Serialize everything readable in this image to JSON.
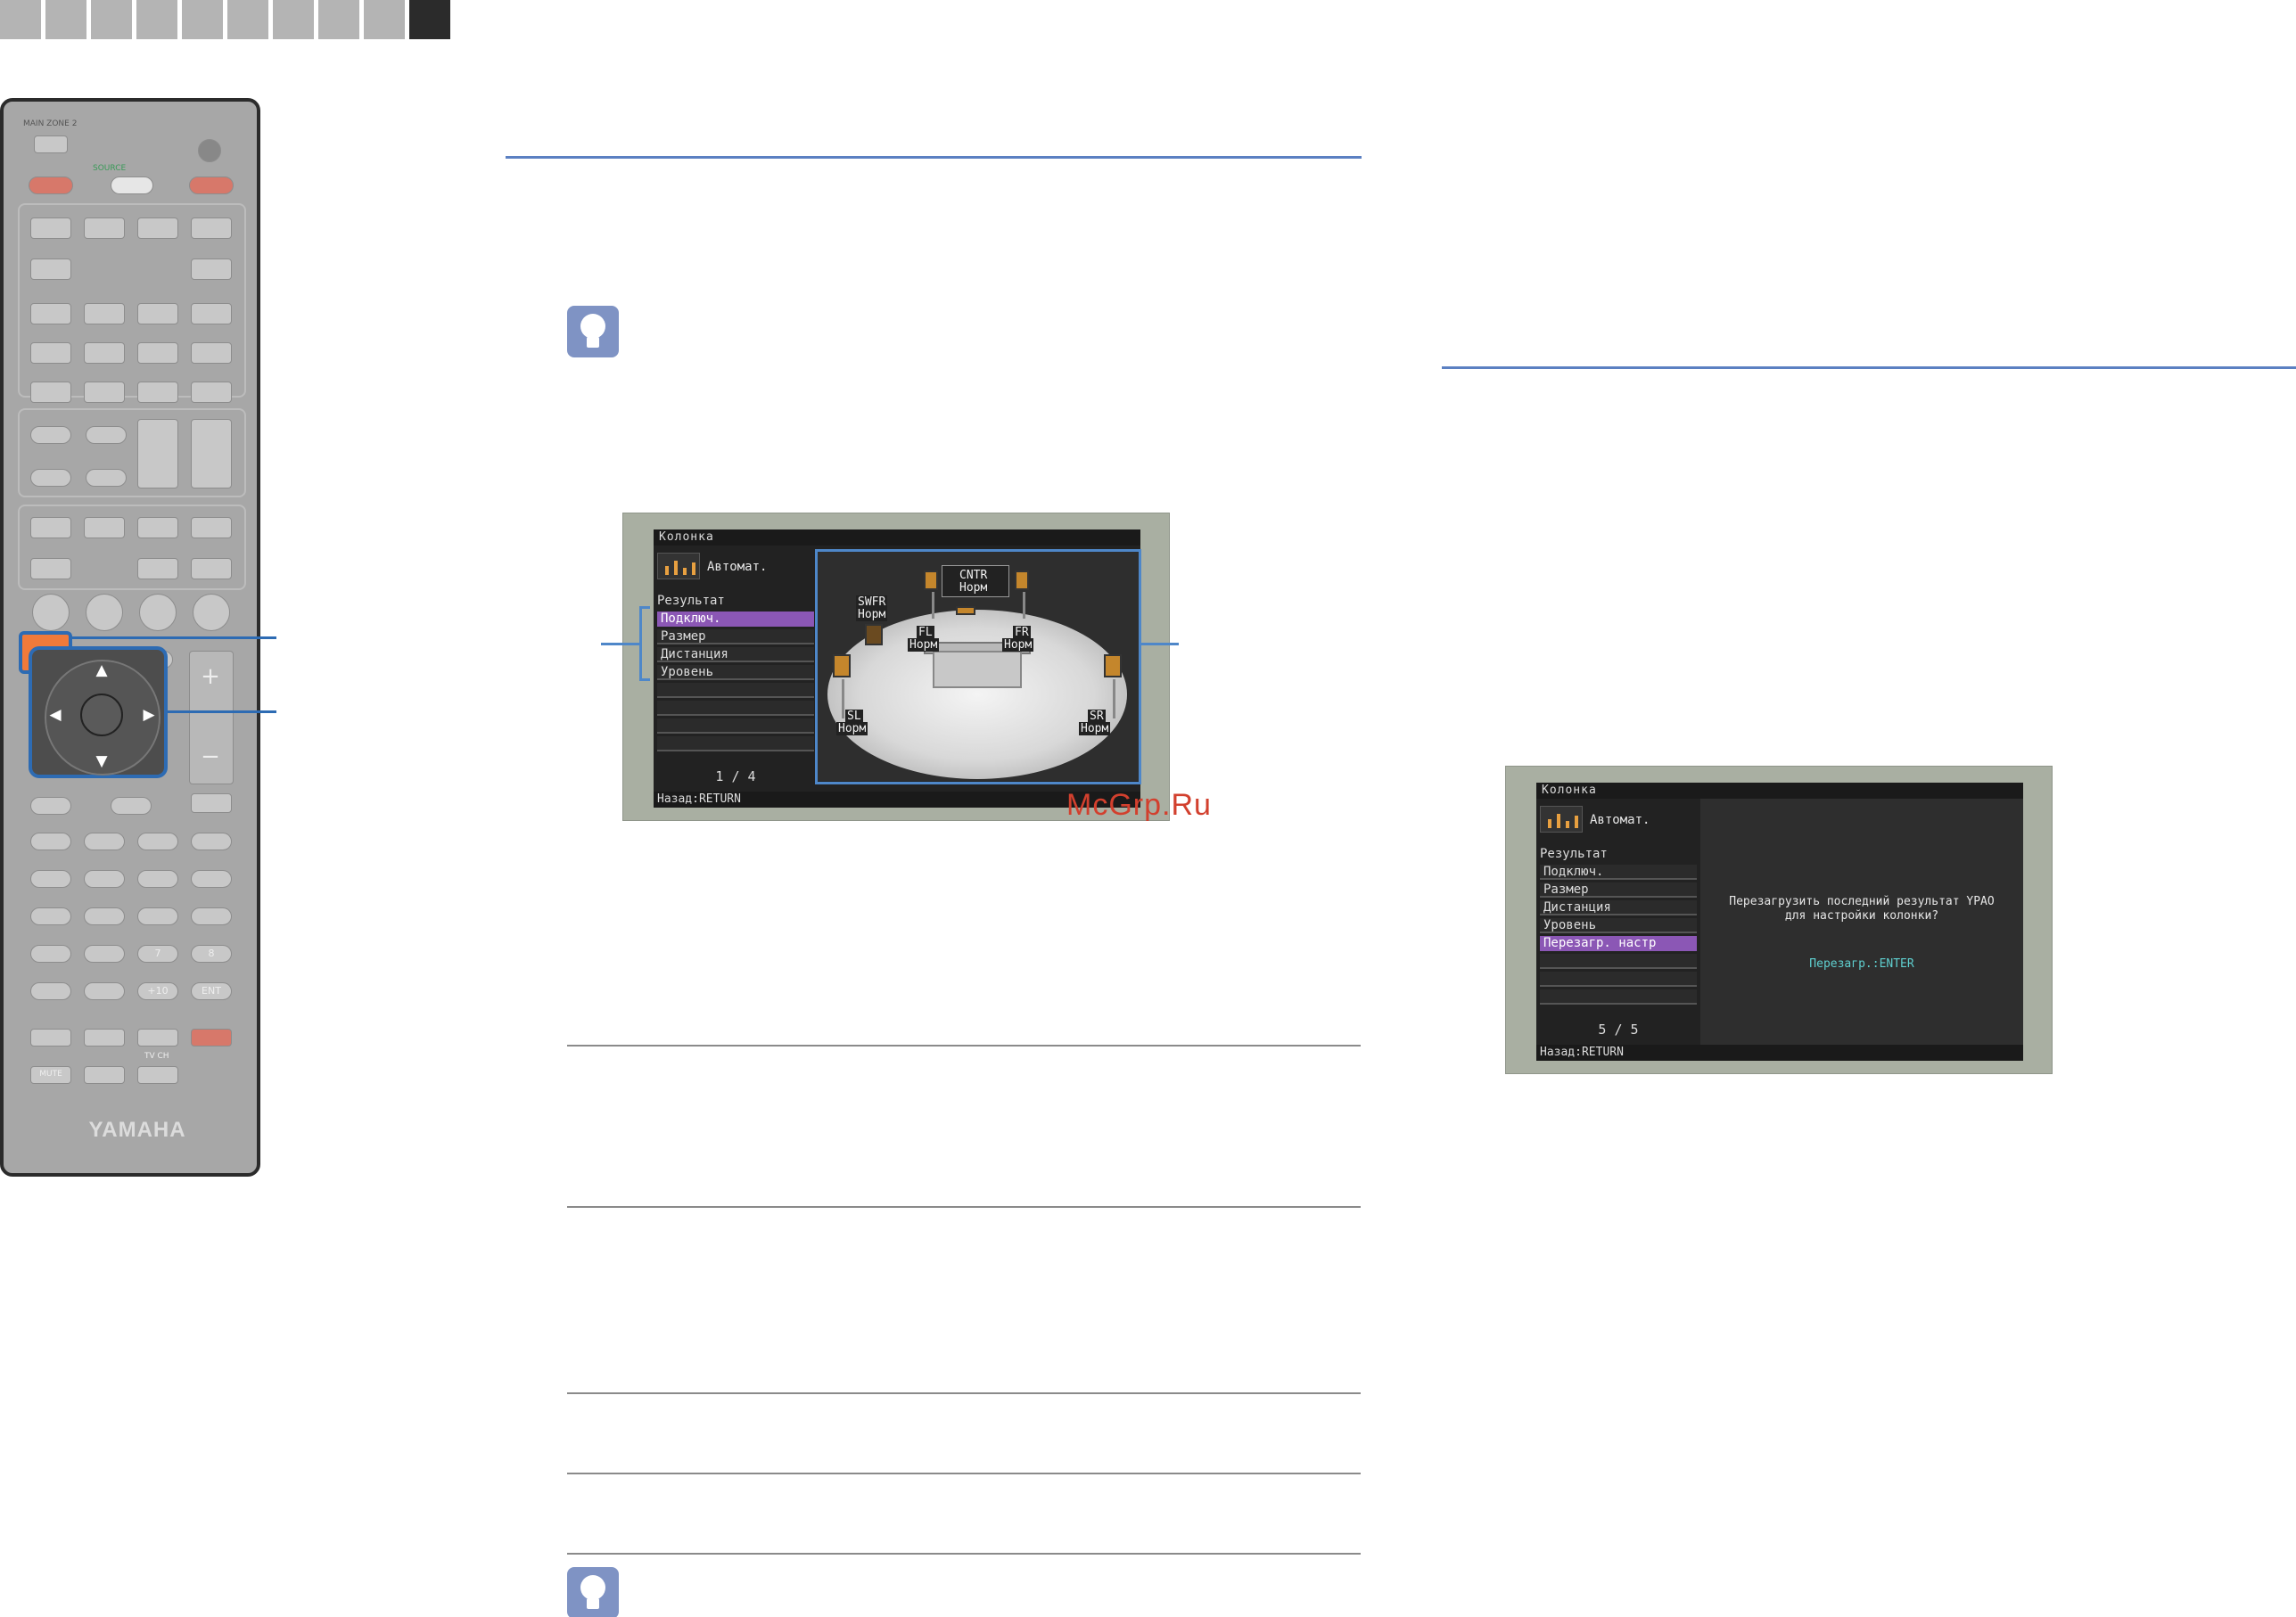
{
  "remote": {
    "switch_label": "MAIN ZONE 2",
    "source_label": "SOURCE",
    "numbers": [
      "7",
      "8"
    ],
    "key_plus10": "+10",
    "key_ent": "ENT",
    "key_mute": "MUTE",
    "key_tvch": "TV CH",
    "logo": "YAMAHA",
    "plus": "+",
    "minus": "−"
  },
  "screen_result": {
    "header": "Колонка",
    "auto_label": "Автомат.",
    "result_title": "Результат",
    "menu": [
      "Подключ.",
      "Размер",
      "Дистанция",
      "Уровень"
    ],
    "selected_index": 0,
    "page": "1 / 4",
    "footer": "Назад:RETURN",
    "speakers": {
      "cntr": {
        "name": "CNTR",
        "state": "Норм"
      },
      "swfr": {
        "name": "SWFR",
        "state": "Норм"
      },
      "fl": {
        "name": "FL",
        "state": "Норм"
      },
      "fr": {
        "name": "FR",
        "state": "Норм"
      },
      "sl": {
        "name": "SL",
        "state": "Норм"
      },
      "sr": {
        "name": "SR",
        "state": "Норм"
      }
    }
  },
  "screen_reload": {
    "header": "Колонка",
    "auto_label": "Автомат.",
    "result_title": "Результат",
    "menu": [
      "Подключ.",
      "Размер",
      "Дистанция",
      "Уровень",
      "Перезагр. настр"
    ],
    "selected_index": 4,
    "page": "5 / 5",
    "footer": "Назад:RETURN",
    "message_line1": "Перезагрузить последний результат YPAO",
    "message_line2": "для настройки колонки?",
    "enter_hint": "Перезагр.:ENTER"
  },
  "watermark": "McGrp.Ru",
  "colors": {
    "accent_blue": "#2d6bb3",
    "rule_blue": "#5b80c2",
    "highlight_purple": "#8b57b5",
    "hint_icon": "#7f93c4",
    "watermark": "#d2402e"
  }
}
